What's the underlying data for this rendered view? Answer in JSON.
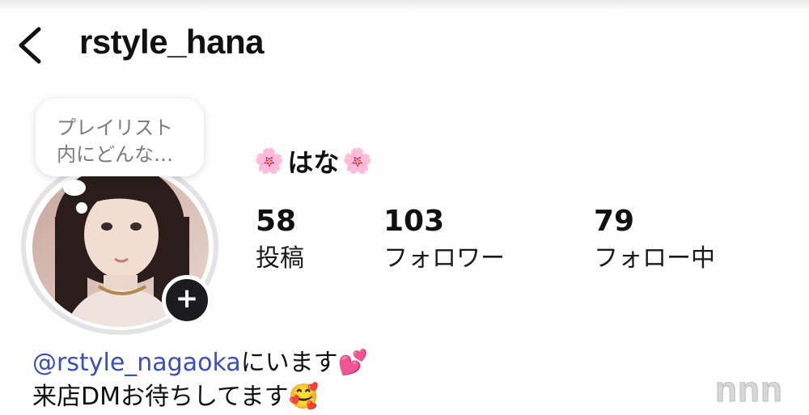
{
  "header": {
    "username": "rstyle_hana"
  },
  "note": {
    "text": "プレイリスト\n内にどんな…"
  },
  "profile": {
    "display_name": "はな",
    "stats": [
      {
        "value": "58",
        "label": "投稿"
      },
      {
        "value": "103",
        "label": "フォロワー"
      },
      {
        "value": "79",
        "label": "フォロー中"
      }
    ]
  },
  "bio": {
    "mention": "@rstyle_nagaoka",
    "line1_rest": "にいます",
    "line2": "来店DMお待ちしてます"
  },
  "colors": {
    "mention": "#3b4fb8",
    "add_button": "#1c1c1f"
  }
}
